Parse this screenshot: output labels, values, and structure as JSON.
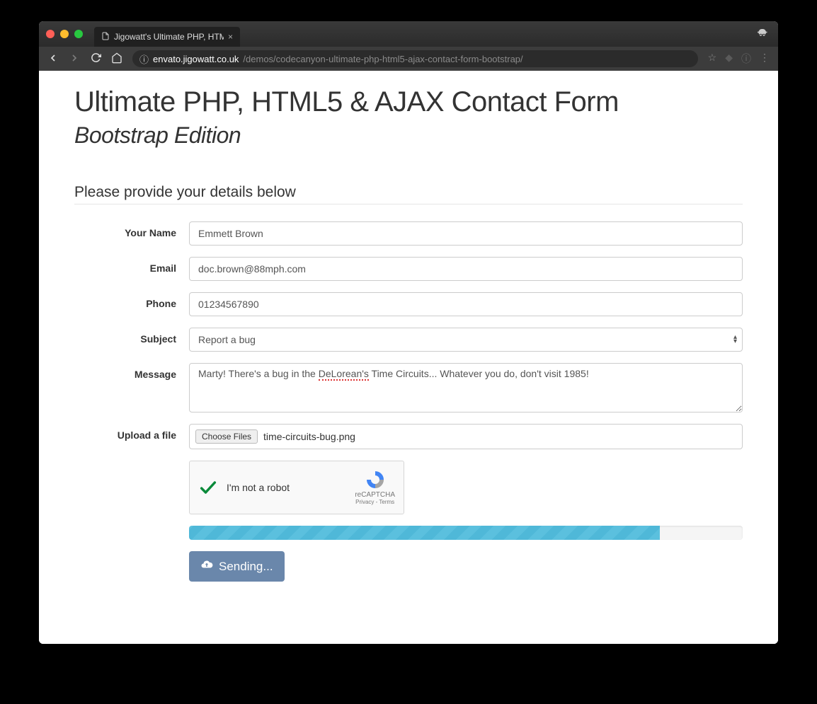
{
  "browser": {
    "tab_title": "Jigowatt's Ultimate PHP, HTML",
    "url_host": "envato.jigowatt.co.uk",
    "url_path": "/demos/codecanyon-ultimate-php-html5-ajax-contact-form-bootstrap/"
  },
  "page": {
    "title": "Ultimate PHP, HTML5 & AJAX Contact Form",
    "subtitle": "Bootstrap Edition",
    "legend": "Please provide your details below"
  },
  "form": {
    "name": {
      "label": "Your Name",
      "value": "Emmett Brown"
    },
    "email": {
      "label": "Email",
      "value": "doc.brown@88mph.com"
    },
    "phone": {
      "label": "Phone",
      "value": "01234567890"
    },
    "subject": {
      "label": "Subject",
      "value": "Report a bug"
    },
    "message": {
      "label": "Message",
      "value_pre": "Marty! There's a bug in the ",
      "value_mid": "DeLorean's",
      "value_post": " Time Circuits... Whatever you do, don't visit 1985!"
    },
    "upload": {
      "label": "Upload a file",
      "button": "Choose Files",
      "filename": "time-circuits-bug.png"
    },
    "recaptcha": {
      "label": "I'm not a robot",
      "brand": "reCAPTCHA",
      "legal": "Privacy - Terms"
    },
    "submit": {
      "label": "Sending..."
    },
    "progress_percent": 85
  }
}
